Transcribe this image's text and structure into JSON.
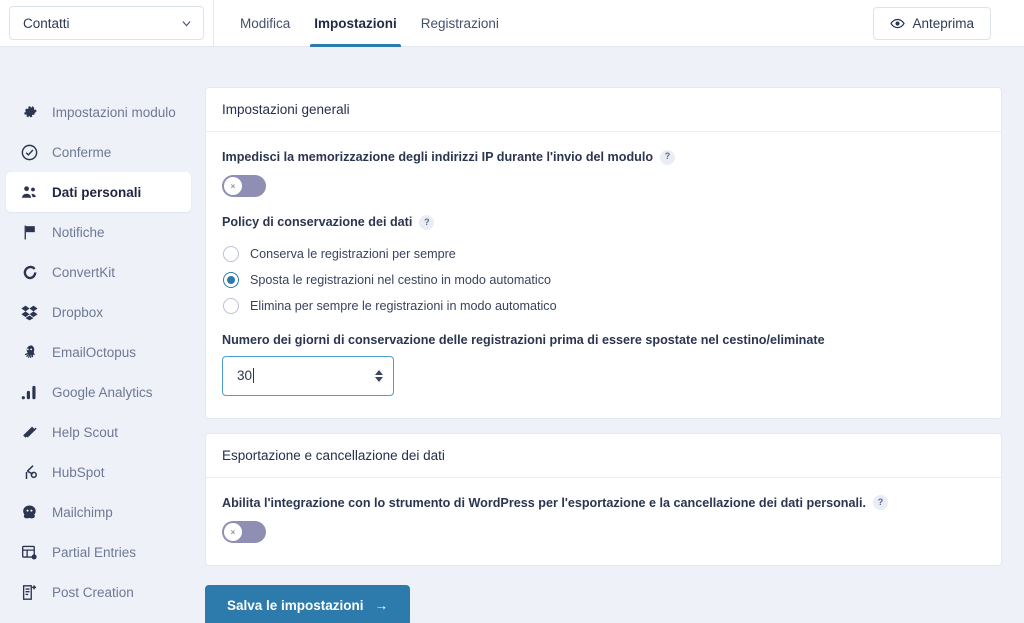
{
  "topbar": {
    "form_selector": {
      "value": "Contatti",
      "icon": "chevron-down-icon"
    },
    "tabs": [
      {
        "label": "Modifica",
        "active": false
      },
      {
        "label": "Impostazioni",
        "active": true
      },
      {
        "label": "Registrazioni",
        "active": false
      }
    ],
    "preview": {
      "label": "Anteprima",
      "icon": "eye-icon"
    }
  },
  "sidebar": {
    "items": [
      {
        "label": "Impostazioni modulo",
        "icon": "gear-icon",
        "active": false
      },
      {
        "label": "Conferme",
        "icon": "check-circle-icon",
        "active": false
      },
      {
        "label": "Dati personali",
        "icon": "users-icon",
        "active": true
      },
      {
        "label": "Notifiche",
        "icon": "flag-icon",
        "active": false
      },
      {
        "label": "ConvertKit",
        "icon": "convertkit-icon",
        "active": false
      },
      {
        "label": "Dropbox",
        "icon": "dropbox-icon",
        "active": false
      },
      {
        "label": "EmailOctopus",
        "icon": "octopus-icon",
        "active": false
      },
      {
        "label": "Google Analytics",
        "icon": "bar-chart-icon",
        "active": false
      },
      {
        "label": "Help Scout",
        "icon": "helpscout-icon",
        "active": false
      },
      {
        "label": "HubSpot",
        "icon": "hubspot-icon",
        "active": false
      },
      {
        "label": "Mailchimp",
        "icon": "mailchimp-icon",
        "active": false
      },
      {
        "label": "Partial Entries",
        "icon": "partial-entries-icon",
        "active": false
      },
      {
        "label": "Post Creation",
        "icon": "post-creation-icon",
        "active": false
      }
    ]
  },
  "general": {
    "card_title": "Impostazioni generali",
    "ip_toggle": {
      "label": "Impedisci la memorizzazione degli indirizzi IP durante l'invio del modulo",
      "help": "?",
      "state": "off",
      "knob_glyph": "×"
    },
    "retention": {
      "label": "Policy di conservazione dei dati",
      "help": "?",
      "options": [
        {
          "label": "Conserva le registrazioni per sempre",
          "selected": false
        },
        {
          "label": "Sposta le registrazioni nel cestino in modo automatico",
          "selected": true
        },
        {
          "label": "Elimina per sempre le registrazioni in modo automatico",
          "selected": false
        }
      ]
    },
    "days": {
      "label": "Numero dei giorni di conservazione delle registrazioni prima di essere spostate nel cestino/eliminate",
      "value": "30",
      "focused": true
    }
  },
  "export": {
    "card_title": "Esportazione e cancellazione dei dati",
    "wp_toggle": {
      "label": "Abilita l'integrazione con lo strumento di WordPress per l'esportazione e la cancellazione dei dati personali.",
      "help": "?",
      "state": "off",
      "knob_glyph": "×"
    }
  },
  "footer": {
    "save_label": "Salva le impostazioni",
    "save_arrow": "→"
  },
  "colors": {
    "accent": "#2d7bac",
    "toggle_off": "#8e8fb2",
    "page_bg": "#eef2f8",
    "text": "#25314c"
  }
}
